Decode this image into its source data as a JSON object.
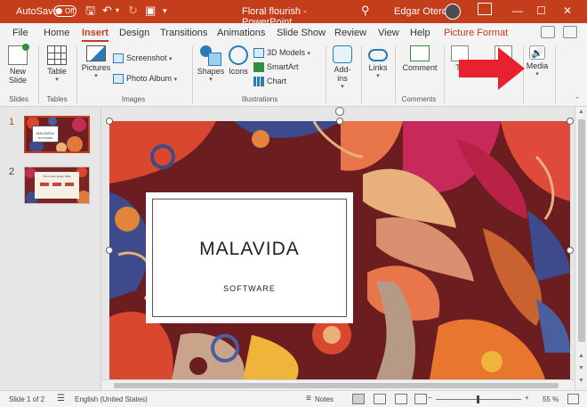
{
  "titlebar": {
    "autosave_label": "AutoSave",
    "autosave_state": "Off",
    "doc_title": "Floral flourish - PowerPoint",
    "user_name": "Edgar Otero",
    "icons": [
      "save-icon",
      "undo-icon",
      "redo-icon",
      "present-icon",
      "customize-icon",
      "search-icon"
    ]
  },
  "tabs": [
    "File",
    "Home",
    "Insert",
    "Design",
    "Transitions",
    "Animations",
    "Slide Show",
    "Review",
    "View",
    "Help",
    "Picture Format"
  ],
  "active_tab": "Insert",
  "ribbon": {
    "new_slide": "New\nSlide",
    "new_slide_line1": "New",
    "new_slide_line2": "Slide",
    "table": "Table",
    "pictures": "Pictures",
    "screenshot": "Screenshot",
    "photo_album": "Photo Album",
    "shapes": "Shapes",
    "icons": "Icons",
    "models3d": "3D Models",
    "smartart": "SmartArt",
    "chart": "Chart",
    "addins_line1": "Add-",
    "addins_line2": "ins",
    "links": "Links",
    "comment": "Comment",
    "text": "Te",
    "symbols": "ols",
    "media": "Media",
    "groups": {
      "slides": "Slides",
      "tables": "Tables",
      "images": "Images",
      "illustrations": "Illustrations",
      "comments": "Comments"
    }
  },
  "slides_panel": {
    "items": [
      {
        "number": "1",
        "title": "MALAVIDA",
        "subtitle": "SOFTWARE"
      },
      {
        "number": "2",
        "title": "The Lorem Ipsum Slide"
      }
    ]
  },
  "slide": {
    "title": "MALAVIDA",
    "subtitle": "SOFTWARE"
  },
  "statusbar": {
    "slide_info": "Slide 1 of 2",
    "language": "English (United States)",
    "notes": "Notes",
    "zoom": "55 %"
  },
  "colors": {
    "accent": "#c43e1c",
    "arrow": "#e8212e"
  }
}
